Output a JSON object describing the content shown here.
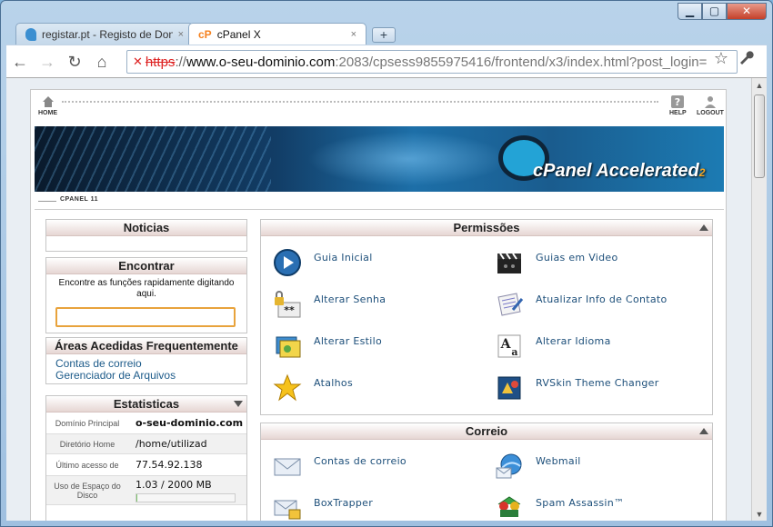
{
  "window": {
    "minimize": "▁",
    "maximize": "▢",
    "close": "✕"
  },
  "tabs": [
    {
      "title": "registar.pt - Registo de Don",
      "close": "×"
    },
    {
      "title": "cPanel X",
      "close": "×",
      "favicon": "cP"
    }
  ],
  "newtab": "+",
  "toolbar": {
    "back": "←",
    "forward": "→",
    "reload": "↻",
    "home": "⌂",
    "url_scheme": "https",
    "url_sep": "://",
    "url_host": "www.o-seu-dominio.com",
    "url_rest": ":2083/cpsess9855975416/frontend/x3/index.html?post_login=",
    "star": "☆",
    "wrench": "🔧"
  },
  "cpanel_nav": {
    "home": "HOME",
    "help": "HELP",
    "logout": "LOGOUT"
  },
  "banner": {
    "brand": "cPanel",
    "tag": "Accelerated",
    "sub": "2"
  },
  "subbar": "CPANEL 11",
  "noticias": {
    "title": "Noticias"
  },
  "encontrar": {
    "title": "Encontrar",
    "description": "Encontre as funções rapidamente digitando aqui.",
    "value": ""
  },
  "frequent": {
    "title": "Áreas Acedidas Frequentemente",
    "links": [
      "Contas de correio",
      "Gerenciador de Arquivos"
    ]
  },
  "stats": {
    "title": "Estatisticas",
    "rows": [
      {
        "key": "Domínio Principal",
        "value": "o-seu-dominio.com"
      },
      {
        "key": "Diretório Home",
        "value": "/home/utilizad"
      },
      {
        "key": "Último acesso de",
        "value": "77.54.92.138"
      },
      {
        "key": "Uso de Espaço do Disco",
        "value": "1.03 / 2000 MB"
      }
    ],
    "disk_fraction": 0.0005
  },
  "permissoes": {
    "title": "Permissões",
    "items": [
      {
        "label": "Guia Inicial",
        "icon": "play-icon"
      },
      {
        "label": "Guias em Video",
        "icon": "clapperboard-icon"
      },
      {
        "label": "Alterar Senha",
        "icon": "password-lock-icon"
      },
      {
        "label": "Atualizar Info de Contato",
        "icon": "contact-icon"
      },
      {
        "label": "Alterar Estilo",
        "icon": "style-icon"
      },
      {
        "label": "Alterar Idioma",
        "icon": "language-icon"
      },
      {
        "label": "Atalhos",
        "icon": "star-icon"
      },
      {
        "label": "RVSkin Theme Changer",
        "icon": "theme-icon"
      }
    ]
  },
  "correio": {
    "title": "Correio",
    "items": [
      {
        "label": "Contas de correio",
        "icon": "envelope-icon"
      },
      {
        "label": "Webmail",
        "icon": "webmail-globe-icon"
      },
      {
        "label": "BoxTrapper",
        "icon": "boxtrapper-icon"
      },
      {
        "label": "Spam Assassin™",
        "icon": "spam-assassin-icon"
      }
    ]
  }
}
